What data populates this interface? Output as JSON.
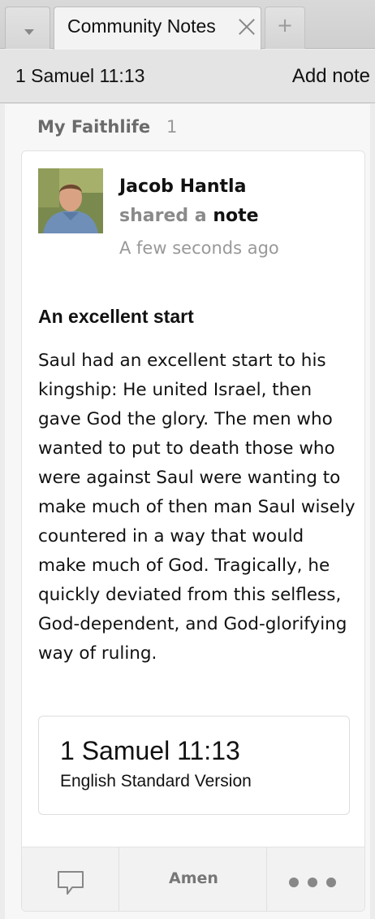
{
  "tabs": {
    "active_title": "Community Notes",
    "new_tab_symbol": "+"
  },
  "header": {
    "reference": "1 Samuel 11:13",
    "add_note": "Add note"
  },
  "group": {
    "name": "My Faithlife",
    "count": "1"
  },
  "post": {
    "author": "Jacob Hantla",
    "action_prefix": "shared a",
    "action_noun": "note",
    "timestamp": "A few seconds ago",
    "title": "An excellent start",
    "body": "Saul had an excellent start to his kingship: He united Israel, then gave God the glory. The men who wanted to put to death those who were against Saul were wanting to make much of then man  Saul wisely countered in a way that would make much of God. Tragically, he quickly deviated from this selfless, God-dependent, and God-glorifying way of ruling.",
    "reference": {
      "title": "1 Samuel 11:13",
      "version": "English Standard Version"
    }
  },
  "footer": {
    "amen": "Amen",
    "comment_icon": "comment-icon",
    "more_icon": "more-icon"
  }
}
